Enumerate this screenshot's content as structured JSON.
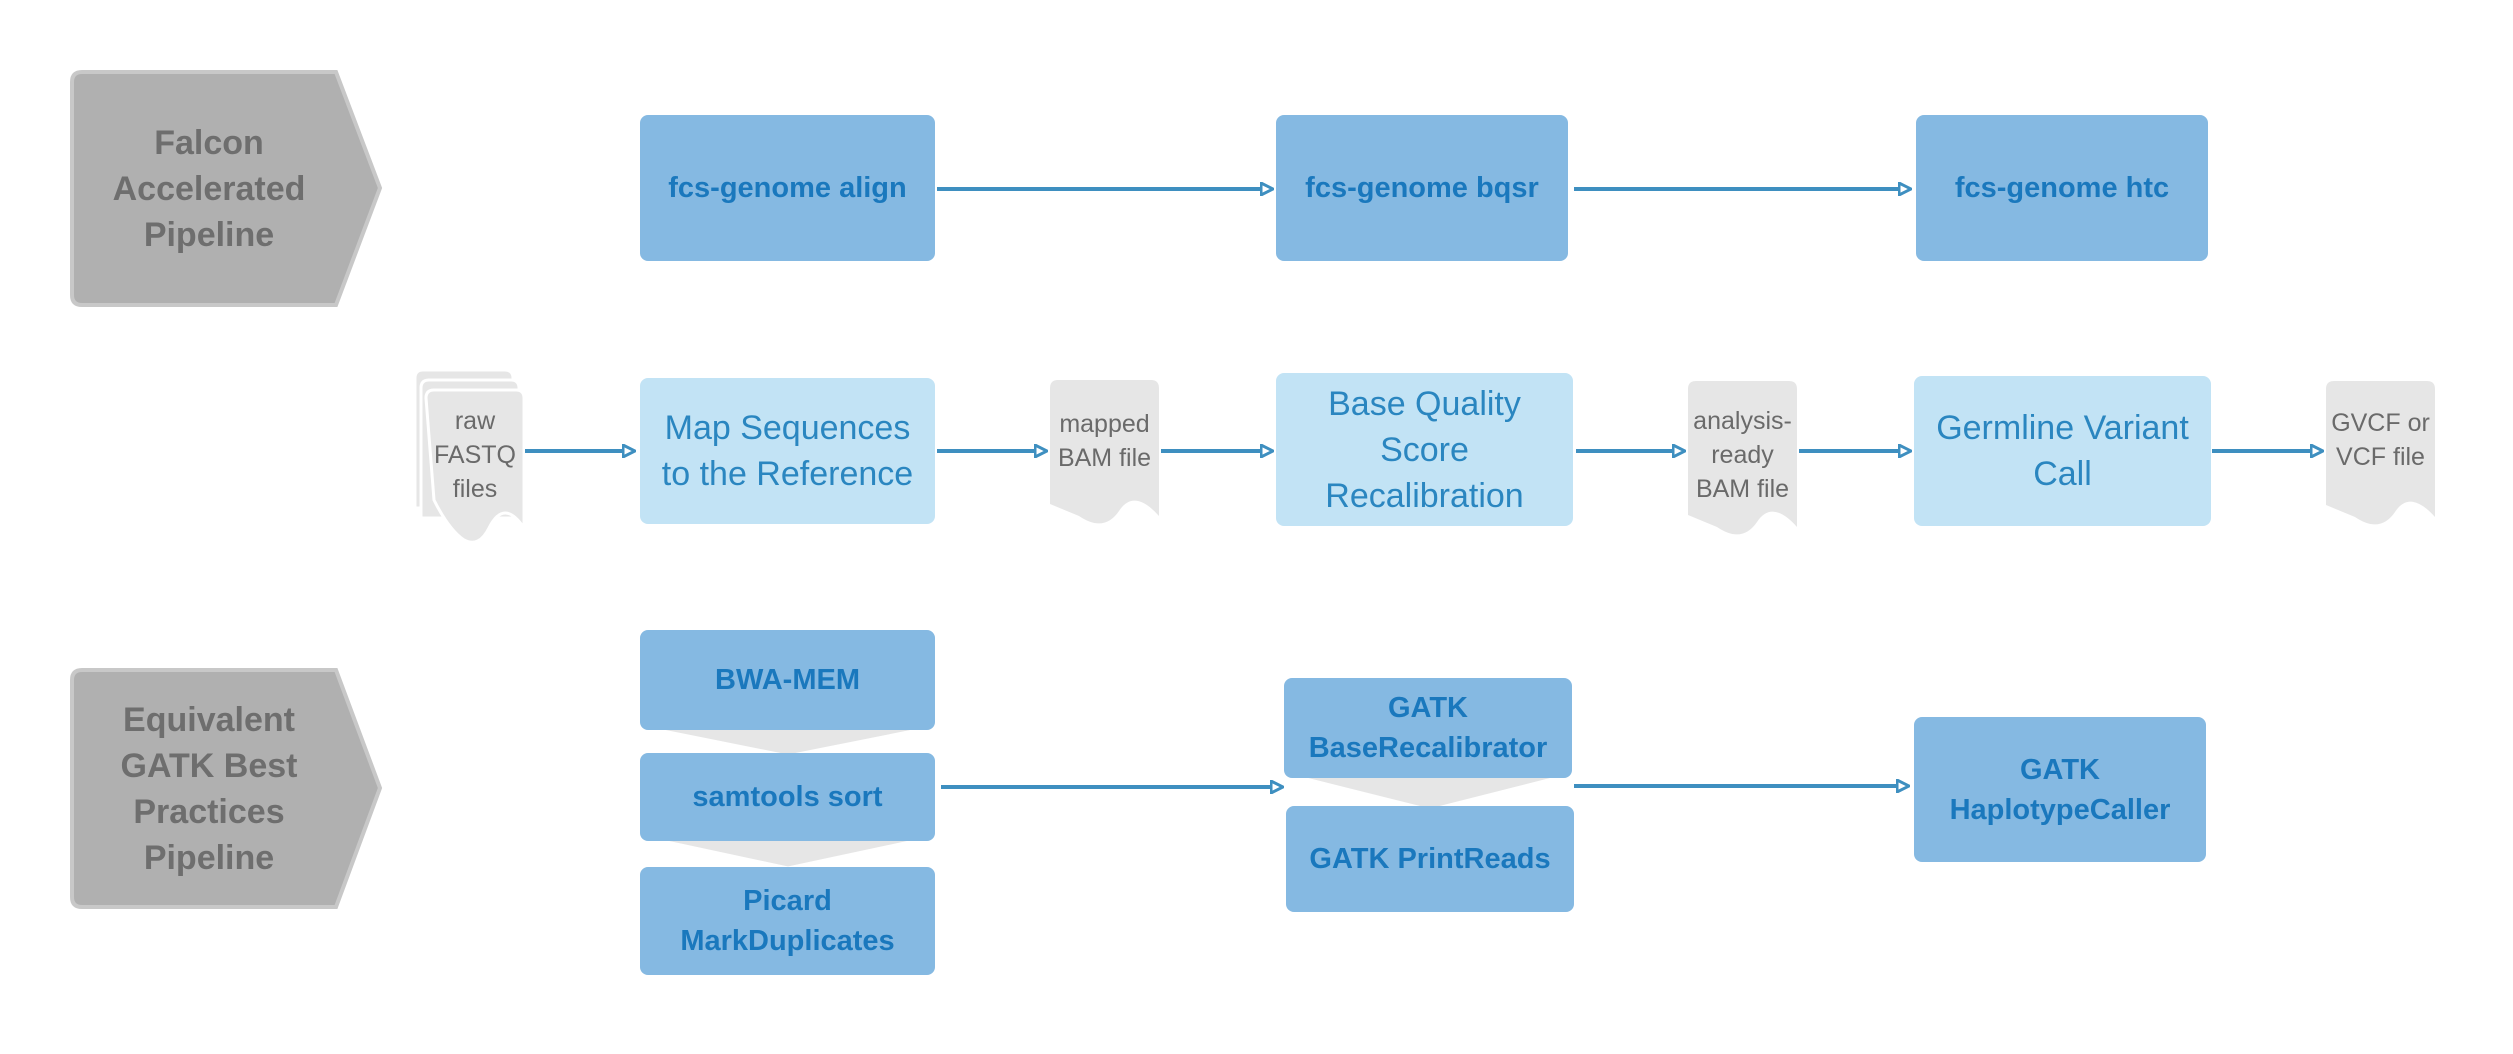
{
  "colors": {
    "dark_box": "#85b9e2",
    "light_box": "#c2e3f5",
    "chevron": "#b0b0b0",
    "document": "#e6e6e6",
    "arrow": "#3e8fc0",
    "dark_text": "#1a78bd"
  },
  "lanes": {
    "falcon": "Falcon Accelerated Pipeline",
    "gatk": "Equivalent GATK Best Practices Pipeline"
  },
  "falcon_steps": [
    "fcs-genome align",
    "fcs-genome bqsr",
    "fcs-genome htc"
  ],
  "stages": [
    "Map Sequences to the Reference",
    "Base Quality Score Recalibration",
    "Germline Variant Call"
  ],
  "files": [
    "raw FASTQ files",
    "mapped BAM file",
    "analysis-ready BAM file",
    "GVCF or VCF file"
  ],
  "gatk_steps": {
    "align": [
      "BWA-MEM",
      "samtools sort",
      "Picard MarkDuplicates"
    ],
    "bqsr": [
      "GATK BaseRecalibrator",
      "GATK PrintReads"
    ],
    "htc": [
      "GATK HaplotypeCaller"
    ]
  }
}
